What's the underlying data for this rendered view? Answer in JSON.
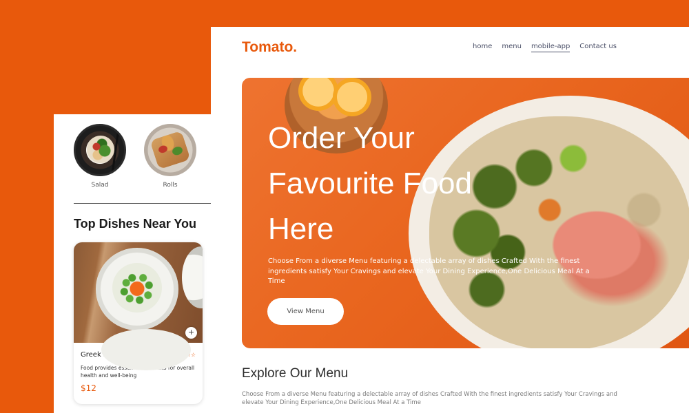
{
  "mobile": {
    "categories": [
      {
        "label": "Salad",
        "image": "salad-bowl"
      },
      {
        "label": "Rolls",
        "image": "wrap-rolls"
      }
    ],
    "section_title": "Top Dishes Near You",
    "food_card": {
      "name": "Greek salad",
      "rating_stars": "★★★★☆",
      "rating": 4,
      "description": "Food provides essential nutrients for overall health and well-being",
      "price": "$12",
      "add_button": "+"
    }
  },
  "desktop": {
    "logo": "Tomato.",
    "nav": [
      {
        "label": "home",
        "active": false
      },
      {
        "label": "menu",
        "active": false
      },
      {
        "label": "mobile-app",
        "active": true
      },
      {
        "label": "Contact us",
        "active": false
      }
    ],
    "hero": {
      "title": "Order Your Favourite Food Here",
      "subtitle": "Choose From a diverse Menu featuring a delectable array of dishes Crafted With the finest ingredients satisfy Your Cravings and elevate Your Dining Experience,One Delicious Meal At a Time",
      "button": "View Menu"
    },
    "explore": {
      "title": "Explore Our Menu",
      "text": "Choose From a diverse Menu featuring a delectable array of dishes Crafted With the finest ingredients satisfy Your Cravings and elevate Your Dining Experience,One Delicious Meal At a Time"
    }
  },
  "colors": {
    "background": "#e8590c",
    "brand": "#e8590c",
    "nav_text": "#4a4f67"
  }
}
